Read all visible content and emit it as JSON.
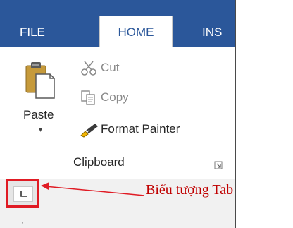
{
  "tabs": {
    "file": "FILE",
    "home": "HOME",
    "insert": "INS"
  },
  "clipboard": {
    "paste_label": "Paste",
    "paste_arrow": "▾",
    "cut_label": "Cut",
    "copy_label": "Copy",
    "format_painter_label": "Format Painter",
    "group_label": "Clipboard"
  },
  "ruler": {
    "tick_mark": "·"
  },
  "callout": {
    "text": "Biểu tượng Tab"
  },
  "colors": {
    "ribbon_tab_bar": "#2b579a",
    "highlight_box": "#e01b24",
    "callout_text": "#c00000"
  },
  "icons": {
    "paste": "paste-icon",
    "cut": "scissors-icon",
    "copy": "copy-icon",
    "format_painter": "paintbrush-icon",
    "dialog_launcher": "dialog-launcher-icon",
    "tab_selector": "left-tab-stop-icon"
  }
}
